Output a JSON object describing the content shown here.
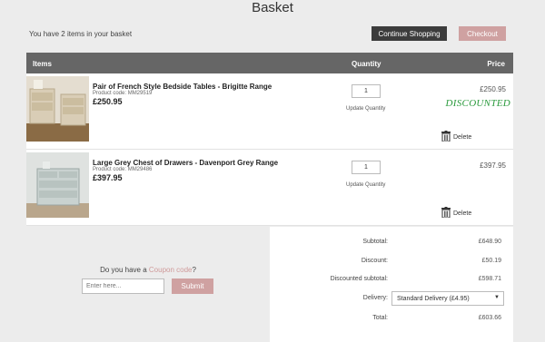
{
  "page": {
    "title": "Basket"
  },
  "basket": {
    "count_text": "You have 2 items in your basket"
  },
  "actions": {
    "continue_label": "Continue Shopping",
    "checkout_label": "Checkout"
  },
  "table": {
    "headers": {
      "items": "Items",
      "quantity": "Quantity",
      "price": "Price"
    }
  },
  "rows": [
    {
      "name": "Pair of French Style Bedside Tables - Brigitte Range",
      "code": "Product code: MM29519",
      "unit_price": "£250.95",
      "quantity": "1",
      "update_label": "Update Quantity",
      "price": "£250.95",
      "status": "DISCOUNTED",
      "delete_label": "Delete"
    },
    {
      "name": "Large Grey Chest of Drawers - Davenport Grey Range",
      "code": "Product code: MM29486",
      "unit_price": "£397.95",
      "quantity": "1",
      "update_label": "Update Quantity",
      "price": "£397.95",
      "delete_label": "Delete"
    }
  ],
  "coupon": {
    "label_prefix": "Do you have a",
    "label_link": "Coupon code",
    "label_suffix": "?",
    "placeholder": "Enter here...",
    "submit_label": "Submit"
  },
  "summary": {
    "subtotal_label": "Subtotal:",
    "subtotal_value": "£648.90",
    "discount_label": "Discount:",
    "discount_value": "£50.19",
    "discounted_subtotal_label": "Discounted subtotal:",
    "discounted_subtotal_value": "£598.71",
    "delivery_label": "Delivery:",
    "delivery_value": "Standard Delivery (£4.95)",
    "total_label": "Total:",
    "total_value": "£603.66"
  },
  "colors": {
    "accent": "#cfa1a1",
    "dark_button": "#3c3c3c",
    "header_bar": "#666666",
    "discount_green": "#2a9a3c"
  },
  "icons": {
    "delete": "trash-icon",
    "dropdown": "chevron-down-icon"
  }
}
